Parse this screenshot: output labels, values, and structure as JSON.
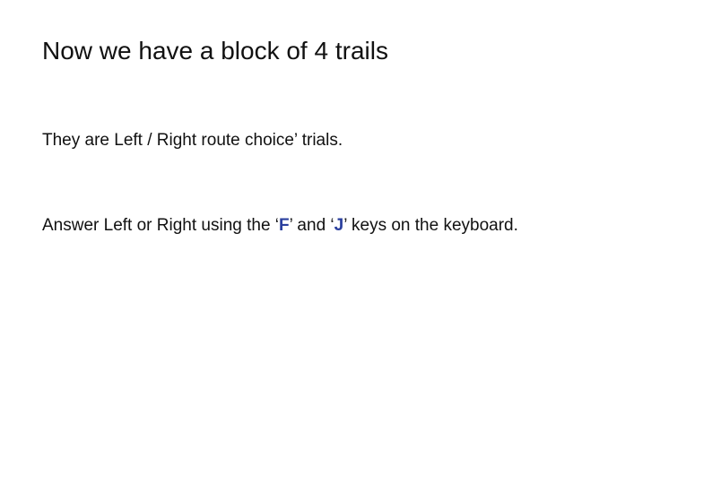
{
  "slide": {
    "title": "Now we have a block of 4 trails",
    "line1": "They are Left / Right route choice’ trials.",
    "line2": {
      "part1": "Answer Left or Right using the ‘",
      "key1": "F",
      "part2": "’ and ‘",
      "key2": "J",
      "part3": "’ keys on the keyboard."
    }
  },
  "colors": {
    "text": "#111111",
    "key_highlight": "#2a3f9e",
    "background": "#ffffff"
  }
}
